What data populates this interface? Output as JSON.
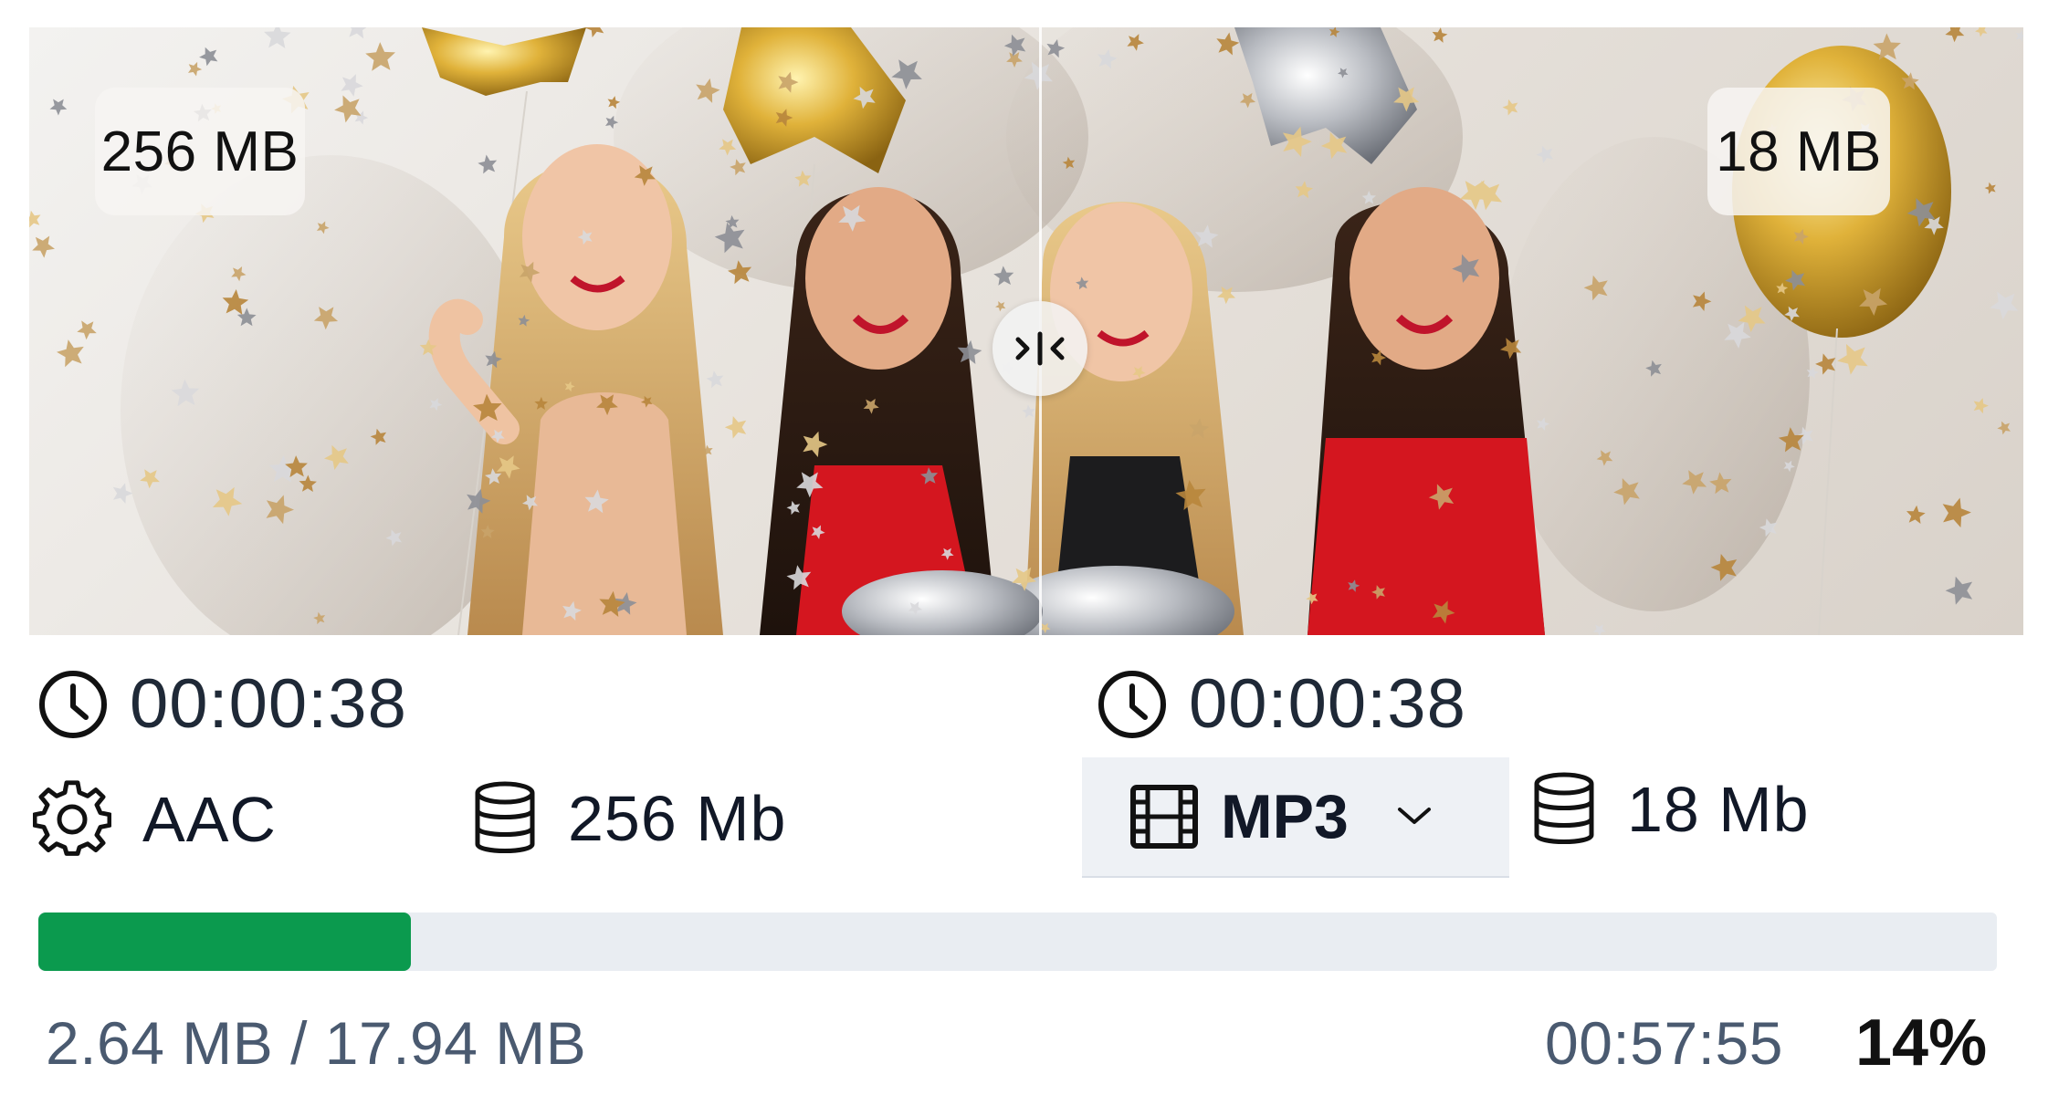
{
  "preview": {
    "original_size": "256 MB",
    "converted_size": "18 MB",
    "split_handle_icon": "compare-split-icon"
  },
  "source": {
    "duration": "00:00:38",
    "codec": "AAC",
    "size": "256 Mb",
    "icons": [
      "clock-icon",
      "gear-icon",
      "database-icon"
    ]
  },
  "output": {
    "duration": "00:00:38",
    "format": "MP3",
    "size": "18 Mb",
    "icons": [
      "clock-icon",
      "film-icon",
      "chevron-down-icon",
      "database-icon"
    ]
  },
  "progress": {
    "bytes_text": "2.64 MB / 17.94 MB",
    "time_remaining": "00:57:55",
    "percent_label": "14%",
    "fraction": 0.19,
    "fill_color": "#0b9a4e",
    "track_color": "#e9edf2"
  }
}
